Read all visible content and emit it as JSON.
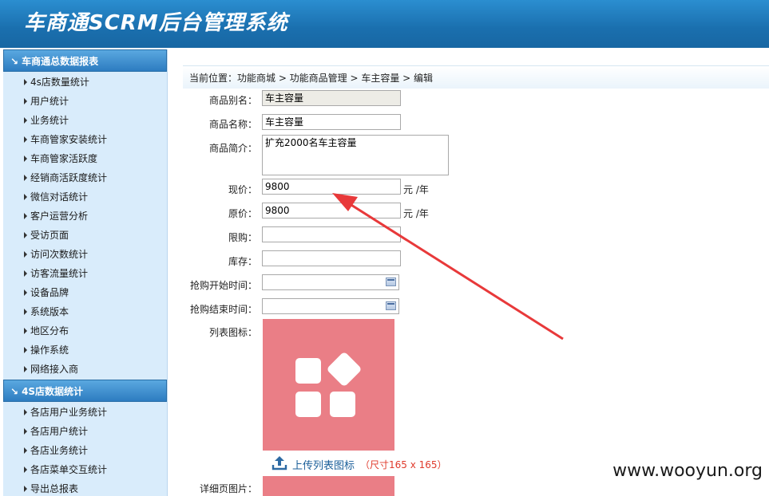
{
  "app": {
    "title": "车商通SCRM后台管理系统"
  },
  "sidebar": {
    "groups": [
      {
        "title": "车商通总数据报表",
        "items": [
          "4s店数量统计",
          "用户统计",
          "业务统计",
          "车商管家安装统计",
          "车商管家活跃度",
          "经销商活跃度统计",
          "微信对话统计",
          "客户运营分析",
          "受访页面",
          "访问次数统计",
          "访客流量统计",
          "设备品牌",
          "系统版本",
          "地区分布",
          "操作系统",
          "网络接入商"
        ]
      },
      {
        "title": "4S店数据统计",
        "items": [
          "各店用户业务统计",
          "各店用户统计",
          "各店业务统计",
          "各店菜单交互统计",
          "导出总报表"
        ]
      }
    ]
  },
  "breadcrumb": {
    "text": "当前位置：功能商城 > 功能商品管理 > 车主容量 > 编辑"
  },
  "form": {
    "alias": {
      "label": "商品别名：",
      "value": "车主容量"
    },
    "name": {
      "label": "商品名称：",
      "value": "车主容量"
    },
    "intro": {
      "label": "商品简介：",
      "value": "扩充2000名车主容量"
    },
    "price_now": {
      "label": "现价：",
      "value": "9800",
      "unit": "元 /年"
    },
    "price_orig": {
      "label": "原价：",
      "value": "9800",
      "unit": "元 /年"
    },
    "limit": {
      "label": "限购：",
      "value": ""
    },
    "stock": {
      "label": "库存：",
      "value": ""
    },
    "start_time": {
      "label": "抢购开始时间：",
      "value": ""
    },
    "end_time": {
      "label": "抢购结束时间：",
      "value": ""
    },
    "list_icon": {
      "label": "列表图标："
    },
    "upload": {
      "link": "上传列表图标",
      "size_note": "（尺寸165 x 165）"
    },
    "detail_image": {
      "label": "详细页图片："
    }
  },
  "watermark": "www.wooyun.org",
  "colors": {
    "header": "#1a6fae",
    "sidebar_bg": "#d9ecfb",
    "icon_bg": "#ea7e86",
    "arrow": "#e8393a"
  }
}
